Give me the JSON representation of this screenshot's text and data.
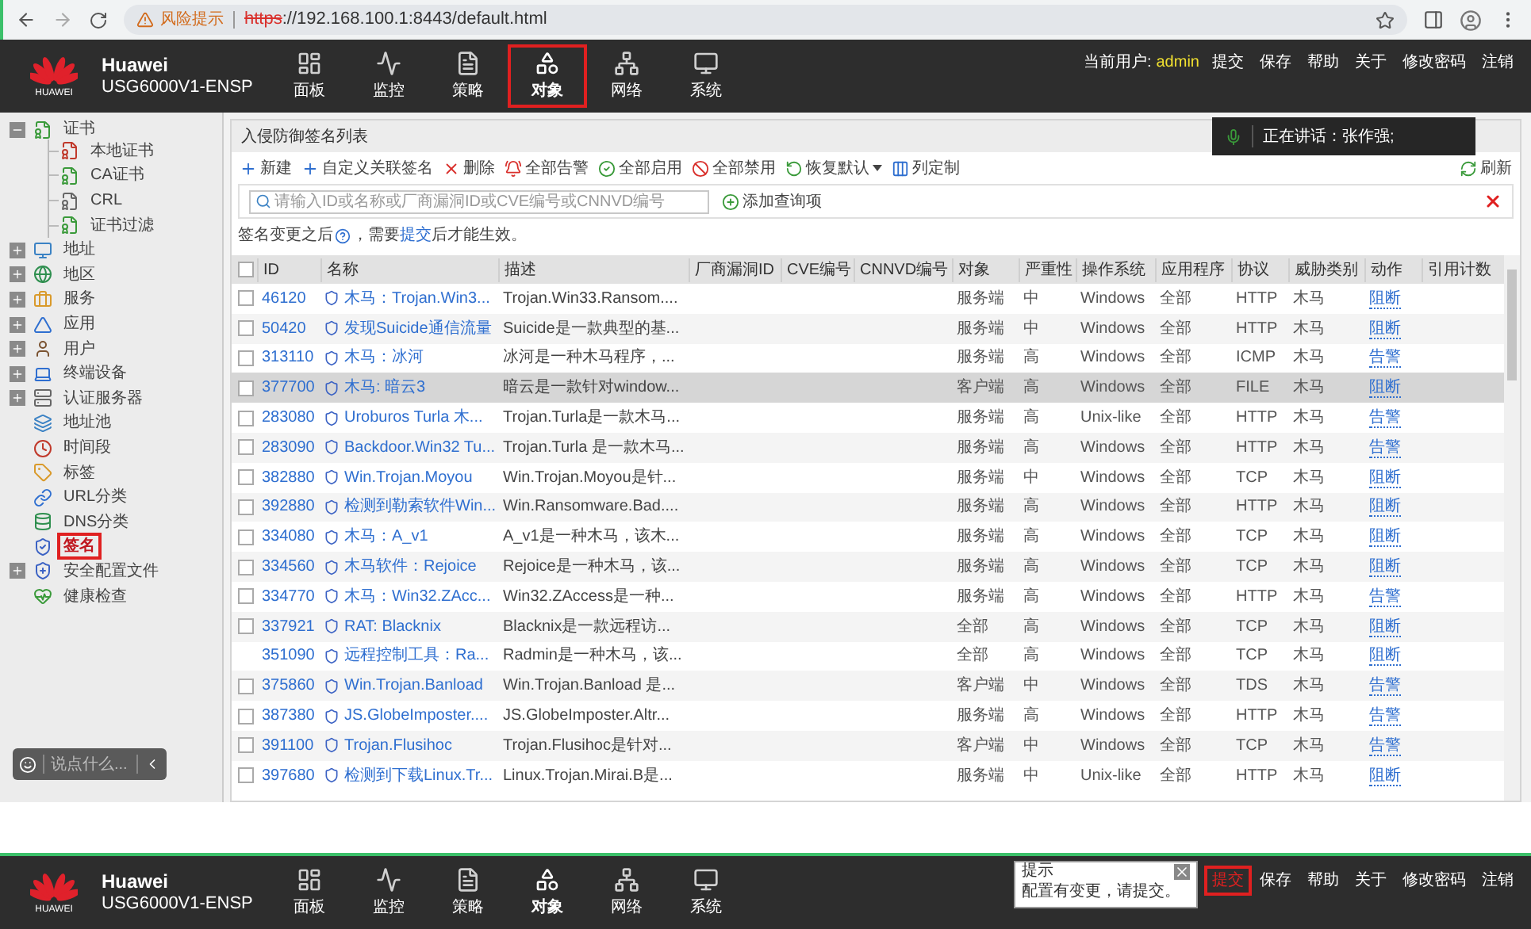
{
  "browser": {
    "warning": "风险提示",
    "url_scheme": "https",
    "url_rest": "://192.168.100.1:8443/default.html"
  },
  "header": {
    "brand": "Huawei",
    "model": "USG6000V1-ENSP",
    "logo_text": "HUAWEI",
    "user_label": "当前用户:",
    "user": "admin",
    "nav": [
      {
        "label": "面板",
        "selected": false,
        "marked": false
      },
      {
        "label": "监控",
        "selected": false,
        "marked": false
      },
      {
        "label": "策略",
        "selected": false,
        "marked": false
      },
      {
        "label": "对象",
        "selected": true,
        "marked": true
      },
      {
        "label": "网络",
        "selected": false,
        "marked": false
      },
      {
        "label": "系统",
        "selected": false,
        "marked": false
      }
    ],
    "links": [
      {
        "label": "提交",
        "marked": false
      },
      {
        "label": "保存",
        "marked": false
      },
      {
        "label": "帮助",
        "marked": false
      },
      {
        "label": "关于",
        "marked": false
      },
      {
        "label": "修改密码",
        "marked": false
      },
      {
        "label": "注销",
        "marked": false
      }
    ]
  },
  "sidebar": {
    "items": [
      {
        "label": "证书",
        "kind": "group",
        "expanded": true,
        "selected": false,
        "marked": false,
        "children": [
          {
            "label": "本地证书",
            "selected": false,
            "marked": false
          },
          {
            "label": "CA证书",
            "selected": false,
            "marked": false
          },
          {
            "label": "CRL",
            "selected": false,
            "marked": false
          },
          {
            "label": "证书过滤",
            "selected": false,
            "marked": false
          }
        ]
      },
      {
        "label": "地址",
        "kind": "group",
        "expanded": false,
        "selected": false,
        "marked": false
      },
      {
        "label": "地区",
        "kind": "group",
        "expanded": false,
        "selected": false,
        "marked": false
      },
      {
        "label": "服务",
        "kind": "group",
        "expanded": false,
        "selected": false,
        "marked": false
      },
      {
        "label": "应用",
        "kind": "group",
        "expanded": false,
        "selected": false,
        "marked": false
      },
      {
        "label": "用户",
        "kind": "group",
        "expanded": false,
        "selected": false,
        "marked": false
      },
      {
        "label": "终端设备",
        "kind": "group",
        "expanded": false,
        "selected": false,
        "marked": false
      },
      {
        "label": "认证服务器",
        "kind": "group",
        "expanded": false,
        "selected": false,
        "marked": false
      },
      {
        "label": "地址池",
        "kind": "leaf",
        "selected": false,
        "marked": false
      },
      {
        "label": "时间段",
        "kind": "leaf",
        "selected": false,
        "marked": false
      },
      {
        "label": "标签",
        "kind": "leaf",
        "selected": false,
        "marked": false
      },
      {
        "label": "URL分类",
        "kind": "leaf",
        "selected": false,
        "marked": false
      },
      {
        "label": "DNS分类",
        "kind": "leaf",
        "selected": false,
        "marked": false
      },
      {
        "label": "签名",
        "kind": "leaf",
        "selected": true,
        "marked": true
      },
      {
        "label": "安全配置文件",
        "kind": "group",
        "expanded": false,
        "selected": false,
        "marked": false
      },
      {
        "label": "健康检查",
        "kind": "leaf",
        "selected": false,
        "marked": false
      }
    ],
    "chat": {
      "placeholder": "说点什么..."
    }
  },
  "voice": {
    "text": "正在讲话：张作强;"
  },
  "panel": {
    "title": "入侵防御签名列表",
    "toolbar": [
      {
        "label": "新建",
        "kind": "button"
      },
      {
        "label": "自定义关联签名",
        "kind": "button"
      },
      {
        "label": "删除",
        "kind": "button"
      },
      {
        "label": "全部告警",
        "kind": "button"
      },
      {
        "label": "全部启用",
        "kind": "button"
      },
      {
        "label": "全部禁用",
        "kind": "button"
      },
      {
        "label": "恢复默认",
        "kind": "menu"
      },
      {
        "label": "列定制",
        "kind": "button"
      }
    ],
    "refresh": "刷新",
    "search": {
      "placeholder": "请输入ID或名称或厂商漏洞ID或CVE编号或CNNVD编号"
    },
    "add_query": "添加查询项",
    "notice": {
      "before": "签名变更之后",
      "middle": "，需要",
      "link": "提交",
      "after": "后才能生效。"
    },
    "all_checked": false,
    "columns": [
      "ID",
      "名称",
      "描述",
      "厂商漏洞ID",
      "CVE编号",
      "CNNVD编号",
      "对象",
      "严重性",
      "操作系统",
      "应用程序",
      "协议",
      "威胁类别",
      "动作",
      "引用计数"
    ],
    "rows": [
      {
        "id": "46120",
        "name": "木马：Trojan.Win3...",
        "desc": "Trojan.Win33.Ransom....",
        "object": "服务端",
        "severity": "中",
        "os": "Windows",
        "app": "全部",
        "protocol": "HTTP",
        "threat": "木马",
        "action": "阻断",
        "kind": "checkbox",
        "checked": false,
        "selected": false
      },
      {
        "id": "50420",
        "name": "发现Suicide通信流量",
        "desc": "Suicide是一款典型的基...",
        "object": "服务端",
        "severity": "中",
        "os": "Windows",
        "app": "全部",
        "protocol": "HTTP",
        "threat": "木马",
        "action": "阻断",
        "kind": "checkbox",
        "checked": false,
        "selected": false
      },
      {
        "id": "313110",
        "name": "木马：冰河",
        "desc": "冰河是一种木马程序，...",
        "object": "服务端",
        "severity": "高",
        "os": "Windows",
        "app": "全部",
        "protocol": "ICMP",
        "threat": "木马",
        "action": "告警",
        "kind": "checkbox",
        "checked": false,
        "selected": false
      },
      {
        "id": "377700",
        "name": "木马: 暗云3",
        "desc": "暗云是一款针对window...",
        "object": "客户端",
        "severity": "高",
        "os": "Windows",
        "app": "全部",
        "protocol": "FILE",
        "threat": "木马",
        "action": "阻断",
        "kind": "checkbox",
        "checked": false,
        "selected": true
      },
      {
        "id": "283080",
        "name": "Uroburos Turla 木...",
        "desc": "Trojan.Turla是一款木马...",
        "object": "服务端",
        "severity": "高",
        "os": "Unix-like",
        "app": "全部",
        "protocol": "HTTP",
        "threat": "木马",
        "action": "告警",
        "kind": "checkbox",
        "checked": false,
        "selected": false
      },
      {
        "id": "283090",
        "name": "Backdoor.Win32 Tu...",
        "desc": "Trojan.Turla 是一款木马...",
        "object": "服务端",
        "severity": "高",
        "os": "Windows",
        "app": "全部",
        "protocol": "HTTP",
        "threat": "木马",
        "action": "告警",
        "kind": "checkbox",
        "checked": false,
        "selected": false
      },
      {
        "id": "382880",
        "name": "Win.Trojan.Moyou",
        "desc": "Win.Trojan.Moyou是针...",
        "object": "服务端",
        "severity": "中",
        "os": "Windows",
        "app": "全部",
        "protocol": "TCP",
        "threat": "木马",
        "action": "阻断",
        "kind": "checkbox",
        "checked": false,
        "selected": false
      },
      {
        "id": "392880",
        "name": "检测到勒索软件Win...",
        "desc": "Win.Ransomware.Bad....",
        "object": "服务端",
        "severity": "高",
        "os": "Windows",
        "app": "全部",
        "protocol": "HTTP",
        "threat": "木马",
        "action": "阻断",
        "kind": "checkbox",
        "checked": false,
        "selected": false
      },
      {
        "id": "334080",
        "name": "木马：A_v1",
        "desc": "A_v1是一种木马，该木...",
        "object": "服务端",
        "severity": "高",
        "os": "Windows",
        "app": "全部",
        "protocol": "TCP",
        "threat": "木马",
        "action": "阻断",
        "kind": "checkbox",
        "checked": false,
        "selected": false
      },
      {
        "id": "334560",
        "name": "木马软件：Rejoice",
        "desc": "Rejoice是一种木马，该...",
        "object": "服务端",
        "severity": "高",
        "os": "Windows",
        "app": "全部",
        "protocol": "TCP",
        "threat": "木马",
        "action": "阻断",
        "kind": "checkbox",
        "checked": false,
        "selected": false
      },
      {
        "id": "334770",
        "name": "木马：Win32.ZAcc...",
        "desc": "Win32.ZAccess是一种...",
        "object": "服务端",
        "severity": "高",
        "os": "Windows",
        "app": "全部",
        "protocol": "HTTP",
        "threat": "木马",
        "action": "告警",
        "kind": "checkbox",
        "checked": false,
        "selected": false
      },
      {
        "id": "337921",
        "name": "RAT: Blacknix",
        "desc": "Blacknix是一款远程访...",
        "object": "全部",
        "severity": "高",
        "os": "Windows",
        "app": "全部",
        "protocol": "TCP",
        "threat": "木马",
        "action": "阻断",
        "kind": "checkbox",
        "checked": false,
        "selected": false
      },
      {
        "id": "351090",
        "name": "远程控制工具：Ra...",
        "desc": "Radmin是一种木马，该...",
        "object": "全部",
        "severity": "高",
        "os": "Windows",
        "app": "全部",
        "protocol": "TCP",
        "threat": "木马",
        "action": "阻断",
        "kind": "plain",
        "selected": false
      },
      {
        "id": "375860",
        "name": "Win.Trojan.Banload",
        "desc": "Win.Trojan.Banload 是...",
        "object": "客户端",
        "severity": "中",
        "os": "Windows",
        "app": "全部",
        "protocol": "TDS",
        "threat": "木马",
        "action": "告警",
        "kind": "checkbox",
        "checked": false,
        "selected": false
      },
      {
        "id": "387380",
        "name": "JS.GlobeImposter....",
        "desc": "JS.GlobeImposter.Altr...",
        "object": "服务端",
        "severity": "高",
        "os": "Windows",
        "app": "全部",
        "protocol": "HTTP",
        "threat": "木马",
        "action": "告警",
        "kind": "checkbox",
        "checked": false,
        "selected": false
      },
      {
        "id": "391100",
        "name": "Trojan.Flusihoc",
        "desc": "Trojan.Flusihoc是针对...",
        "object": "客户端",
        "severity": "中",
        "os": "Windows",
        "app": "全部",
        "protocol": "TCP",
        "threat": "木马",
        "action": "告警",
        "kind": "checkbox",
        "checked": false,
        "selected": false
      },
      {
        "id": "397680",
        "name": "检测到下载Linux.Tr...",
        "desc": "Linux.Trojan.Mirai.B是...",
        "object": "服务端",
        "severity": "中",
        "os": "Unix-like",
        "app": "全部",
        "protocol": "HTTP",
        "threat": "木马",
        "action": "阻断",
        "kind": "checkbox",
        "checked": false,
        "selected": false
      }
    ]
  },
  "bottom_header": {
    "brand": "Huawei",
    "model": "USG6000V1-ENSP",
    "logo_text": "HUAWEI",
    "nav": [
      {
        "label": "面板",
        "selected": false,
        "marked": false
      },
      {
        "label": "监控",
        "selected": false,
        "marked": false
      },
      {
        "label": "策略",
        "selected": false,
        "marked": false
      },
      {
        "label": "对象",
        "selected": true,
        "marked": false
      },
      {
        "label": "网络",
        "selected": false,
        "marked": false
      },
      {
        "label": "系统",
        "selected": false,
        "marked": false
      }
    ],
    "tip": {
      "title": "提示",
      "message": "配置有变更，请提交。"
    },
    "links": [
      {
        "label": "提交",
        "marked": true
      },
      {
        "label": "保存",
        "marked": false
      },
      {
        "label": "帮助",
        "marked": false
      },
      {
        "label": "关于",
        "marked": false
      },
      {
        "label": "修改密码",
        "marked": false
      },
      {
        "label": "注销",
        "marked": false
      }
    ]
  }
}
